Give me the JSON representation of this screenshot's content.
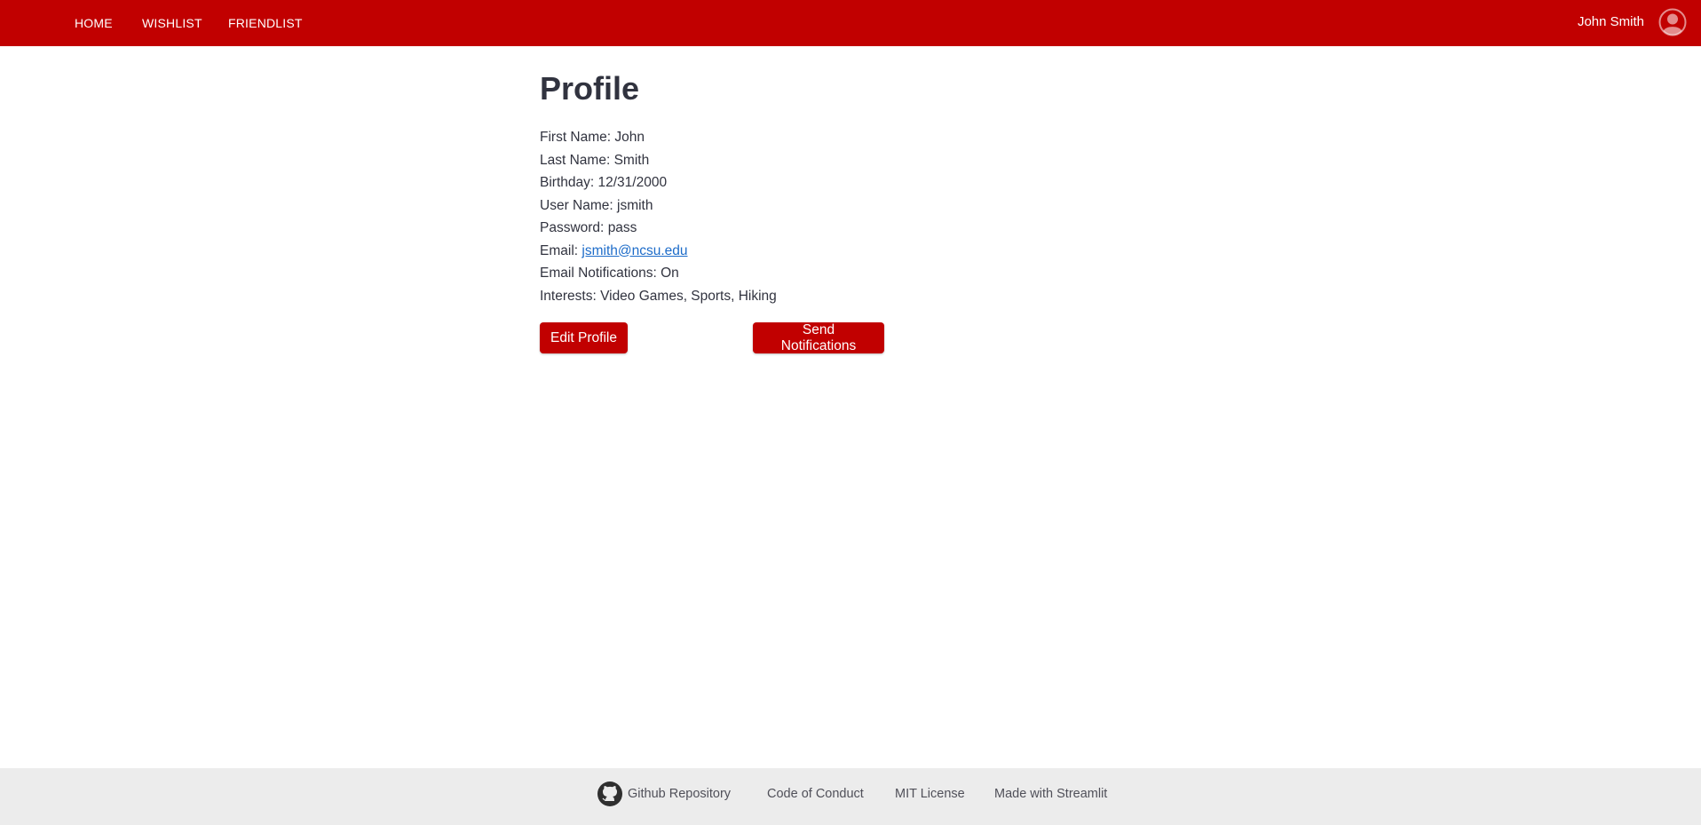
{
  "nav": {
    "items": [
      {
        "label": "HOME"
      },
      {
        "label": "WISHLIST"
      },
      {
        "label": "FRIENDLIST"
      }
    ],
    "user_name": "John Smith",
    "user_icon": "user-avatar-icon",
    "brand_color": "#c10000"
  },
  "profile": {
    "title": "Profile",
    "first_name_label": "First Name:",
    "first_name": "John",
    "last_name_label": "Last Name:",
    "last_name": "Smith",
    "birthday_label": "Birthday:",
    "birthday": "12/31/2000",
    "username_label": "User Name:",
    "username": "jsmith",
    "password_label": "Password:",
    "password": "pass",
    "email_label": "Email:",
    "email": "jsmith@ncsu.edu",
    "notifications_label": "Email Notifications:",
    "notifications": "On",
    "interests_label": "Interests:",
    "interests": "Video Games, Sports, Hiking"
  },
  "actions": {
    "edit_label": "Edit Profile",
    "notify_label": "Send Notifications"
  },
  "footer": {
    "github_icon": "github-icon",
    "links": [
      {
        "label": "Github Repository"
      },
      {
        "label": "Code of Conduct"
      },
      {
        "label": "MIT License"
      },
      {
        "label": "Made with Streamlit"
      }
    ],
    "background": "#ececec"
  }
}
